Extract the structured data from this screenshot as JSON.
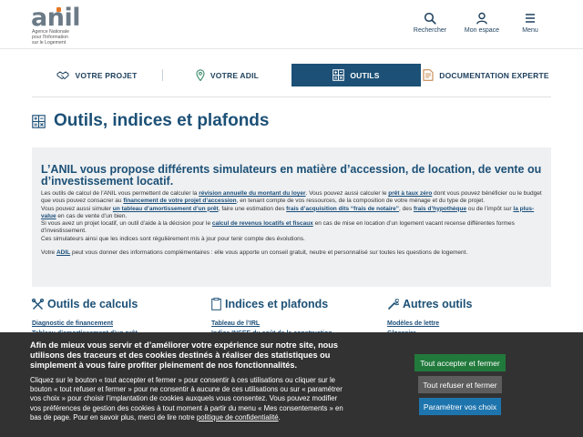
{
  "logo": {
    "word": "anil",
    "subtitle_lines": [
      "Agence Nationale",
      "pour l'Information",
      "sur le Logement"
    ]
  },
  "header": {
    "search_label": "Rechercher",
    "account_label": "Mon espace",
    "menu_label": "Menu"
  },
  "tabs": [
    {
      "label": "VOTRE PROJET",
      "icon": "handshake-icon",
      "active": false
    },
    {
      "label": "VOTRE ADIL",
      "icon": "map-pin-icon",
      "active": false
    },
    {
      "label": "OUTILS",
      "icon": "tools-grid-icon",
      "active": true
    },
    {
      "label": "DOCUMENTATION EXPERTE",
      "icon": "document-icon",
      "active": false
    }
  ],
  "page": {
    "title": "Outils, indices et plafonds",
    "title_icon": "tools-grid-icon"
  },
  "intro": {
    "heading": "L’ANIL vous propose différents simulateurs en matière d’accession, de location, de vente ou d’investissement locatif.",
    "p1_a": "Les outils de calcul de l’ANIL vous permettent de calculer la ",
    "p1_link1": "révision annuelle du montant du loyer",
    "p1_b": ". Vous pouvez aussi calculer le ",
    "p1_link2": "prêt à taux zéro",
    "p1_c": " dont vous pouvez bénéficier ou le budget que vous pouvez consacrer au ",
    "p1_link3": "financement de votre projet d’accession",
    "p1_d": ", en tenant compte de vos ressources, de la composition de votre ménage et du type de projet.",
    "p2_a": "Vous pouvez aussi simuler ",
    "p2_link1": "un tableau d’amortissement d’un prêt",
    "p2_b": ", faire une estimation des ",
    "p2_link2": "frais d’acquisition dits “frais de notaire”",
    "p2_c": ", des ",
    "p2_link3": "frais d’hypothèque",
    "p2_d": " ou de l’impôt sur ",
    "p2_link4": "la plus-value",
    "p2_e": " en cas de vente d’un bien.",
    "p3_a": "Si vous avez un projet locatif, un outil d’aide à la décision pour le ",
    "p3_link1": "calcul de revenus locatifs et fiscaux",
    "p3_b": " en cas de mise en location d’un logement vacant recense différentes formes d’investissement.",
    "p4": "Ces simulateurs ainsi que les indices sont régulièrement mis à jour pour tenir compte des évolutions.",
    "p5_a": "Votre ",
    "p5_link": "ADIL",
    "p5_b": " peut vous donner des informations complémentaires : elle vous apporte un conseil gratuit, neutre et personnalisé sur toutes les questions de logement."
  },
  "columns": [
    {
      "title": "Outils de calculs",
      "icon": "wrench-cross-icon",
      "links": [
        "Diagnostic de financement",
        "Tableau d’amortissement d’un prêt"
      ]
    },
    {
      "title": "Indices et plafonds",
      "icon": "clipboard-icon",
      "links": [
        "Tableau de l’IRL",
        "Indice INSEE du coût de la construction"
      ]
    },
    {
      "title": "Autres outils",
      "icon": "wrench-icon",
      "links": [
        "Modèles de lettre",
        "Glossaire"
      ]
    }
  ],
  "cookie": {
    "title": "Afin de mieux vous servir et d’améliorer votre expérience sur notre site, nous utilisons des traceurs et des cookies destinés à réaliser des statistiques ou simplement à vous faire profiter pleinement de nos fonctionnalités.",
    "text": "Cliquez sur le bouton « tout accepter et fermer » pour consentir à ces utilisations ou cliquer sur le bouton « tout refuser et fermer » pour ne consentir à aucune de ces utilisations ou sur « paramétrer vos choix » pour choisir l’implantation de cookies auxquels vous consentez. Vous pouvez modifier vos préférences de gestion des cookies à tout moment à partir du menu « Mes consentements » en bas de page. Pour en savoir plus, merci de lire notre ",
    "policy_link": "politique de confidentialité",
    "text_end": ".",
    "accept_label": "Tout accepter et fermer",
    "refuse_label": "Tout refuser et fermer",
    "settings_label": "Paramétrer vos choix"
  },
  "colors": {
    "brand_blue": "#1c5076",
    "logo_orange": "#e87722",
    "accept_green": "#217a3c",
    "refuse_grey": "#5d5d5d",
    "settings_blue": "#1e75ae",
    "banner_bg": "#323232"
  }
}
